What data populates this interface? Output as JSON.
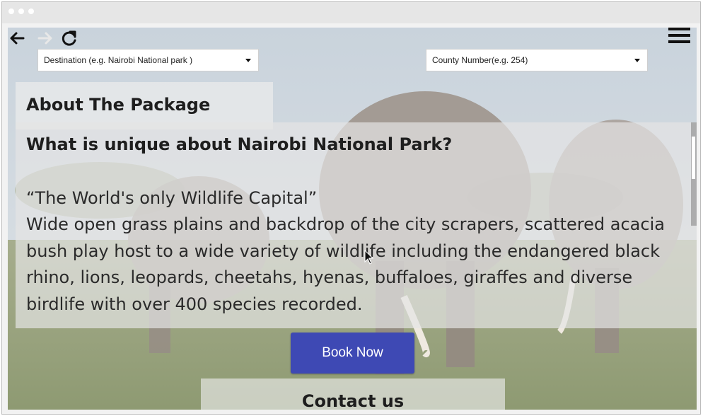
{
  "navigation": {
    "back_icon": "arrow-left-icon",
    "forward_icon": "arrow-right-icon",
    "reload_icon": "reload-icon",
    "menu_icon": "hamburger-menu-icon"
  },
  "filters": {
    "destination_placeholder": "Destination (e.g. Nairobi National park )",
    "county_placeholder": "County Number(e.g. 254)"
  },
  "package": {
    "heading": "About The Package",
    "question": "What is unique about Nairobi National Park?",
    "quote": "“The World's only Wildlife Capital”",
    "description": "Wide open grass plains and backdrop of the city scrapers, scattered acacia bush play host to a wide variety of wildlife including the endangered black rhino, lions, leopards, cheetahs, hyenas, buffaloes, giraffes and diverse birdlife with over 400 species recorded."
  },
  "actions": {
    "book_label": "Book Now",
    "contact_label": "Contact us"
  },
  "colors": {
    "accent": "#3e49b4"
  }
}
